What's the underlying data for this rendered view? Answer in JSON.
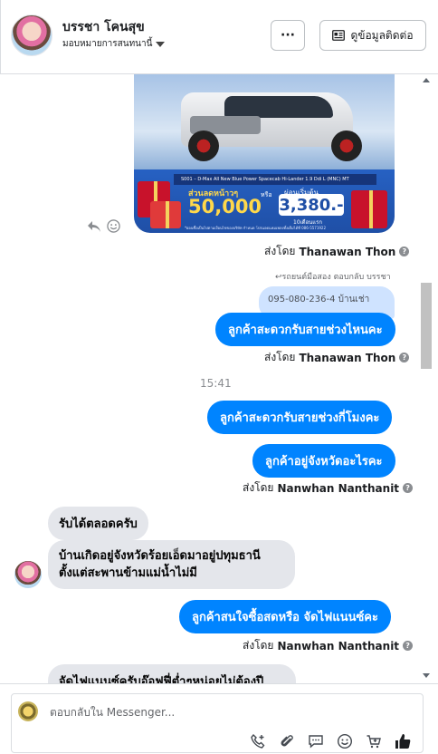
{
  "header": {
    "contact_name": "บรรชา โคนสุข",
    "assignment_label": "มอบหมายการสนทนานี้",
    "more_label": "···",
    "contact_info_label": "ดูข้อมูลติดต่อ"
  },
  "promo": {
    "model_line": "S001 – D-Max All New Blue Power Spacecab Hi-Lander 1.9 Ddi L (MNC) MT",
    "discount_label": "ส่วนลดหน้าวๆ",
    "discount_value": "50,000",
    "or_label": "หรือ",
    "monthly_label": "ผ่อนเริ่มต้น",
    "monthly_value": "3,380.-",
    "months_label": "10เดือนแรก",
    "footnote": "*ผ่อนซื้อเป็นไปตามเงื่อนไขของบริษัท กำหนด โปรแอดแคมเพลงทั้งเต็มได้ที่ 086-5571922"
  },
  "messages": {
    "sent_by_prefix": "ส่งโดย",
    "sent_by_1": "Thanawan Thon",
    "reply_note": "↩รถยนต์มือสอง ตอบกลับ บรรชา",
    "quoted_text": "095-080-236-4 บ้านเช่า",
    "out_1": "ลูกค้าสะดวกรับสายช่วงไหนคะ",
    "sent_by_2": "Thanawan Thon",
    "time": "15:41",
    "out_2": "ลูกค้าสะดวกรับสายช่วงกี่โมงคะ",
    "out_3": "ลูกค้าอยู่จังหวัดอะไรคะ",
    "sent_by_3": "Nanwhan Nanthanit",
    "in_1": "รับได้ตลอดครับ",
    "in_2": "บ้านเกิดอยู่จังหวัดร้อยเอ็ดมาอยู่ปทุมธานี ตั้งแต่สะพานข้ามแม่น้ำไม่มี",
    "out_4": "ลูกค้าสนใจซื้อสดหรือ จัดไฟแนนซ์คะ",
    "sent_by_4": "Nanwhan Nanthanit",
    "in_3": "จัดไฟแนนซ์ครับอ๊อฟฟี่ต่ำๆหน่อยไม่ต้องปี"
  },
  "composer": {
    "placeholder": "ตอบกลับใน Messenger..."
  },
  "colors": {
    "outgoing_bubble": "#0084ff",
    "incoming_bubble": "#e4e6eb",
    "quoted_bubble": "#cfe3ff"
  },
  "icons": [
    "more-icon",
    "contact-card-icon",
    "reply-icon",
    "emoji-icon",
    "info-icon",
    "call-add-icon",
    "attach-icon",
    "saved-replies-icon",
    "emoji-picker-icon",
    "add-to-cart-icon",
    "like-icon"
  ]
}
